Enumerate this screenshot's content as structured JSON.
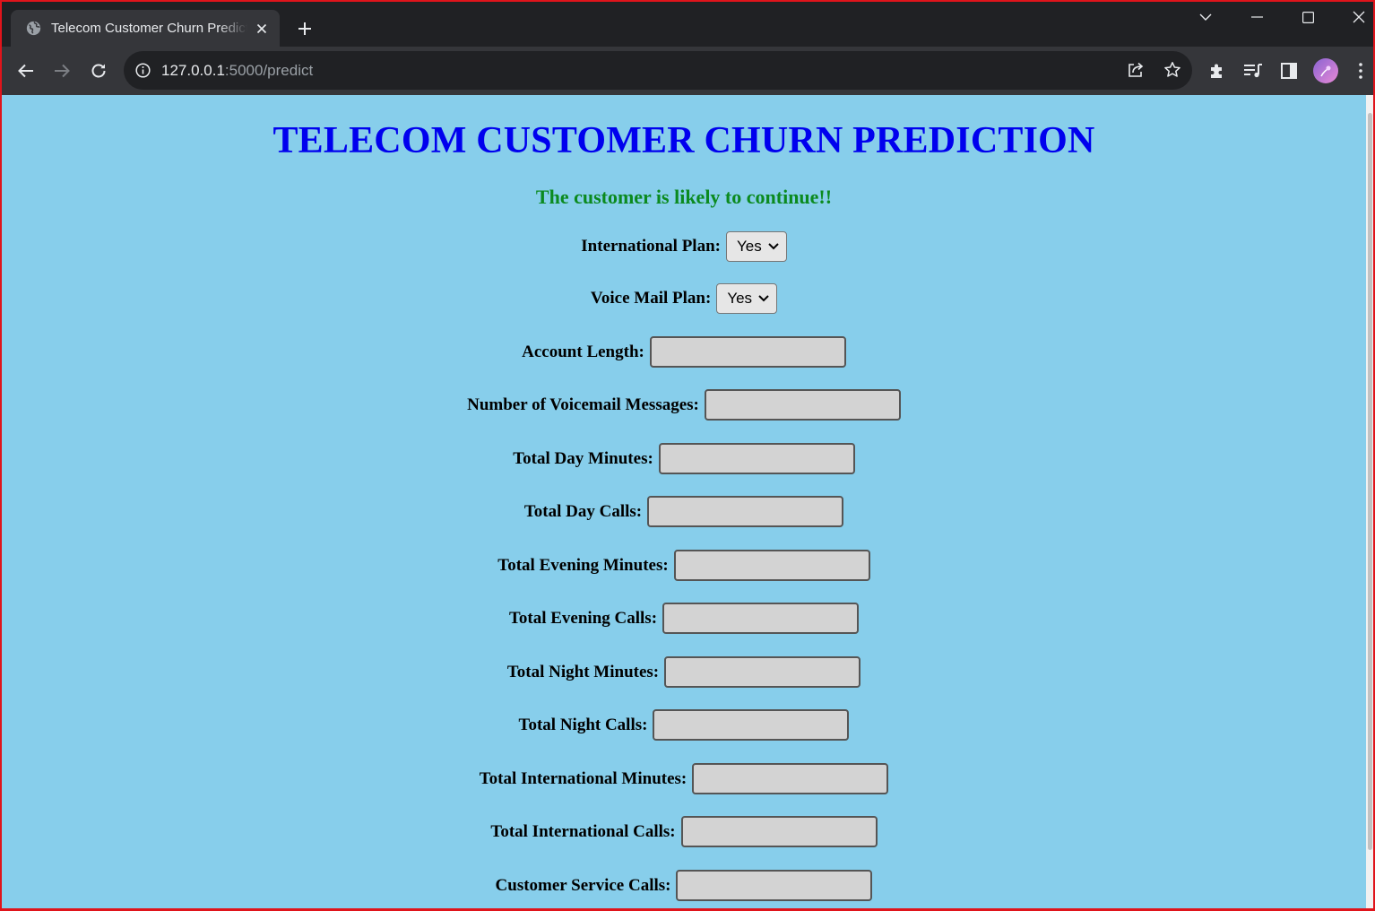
{
  "browser": {
    "tab_title": "Telecom Customer Churn Prediction",
    "url_host": "127.0.0.1",
    "url_rest": ":5000/predict"
  },
  "page": {
    "title": "TELECOM CUSTOMER CHURN PREDICTION",
    "result": "The customer is likely to continue!!",
    "selects": [
      {
        "label": "International Plan:",
        "value": "Yes"
      },
      {
        "label": "Voice Mail Plan:",
        "value": "Yes"
      }
    ],
    "fields": [
      {
        "label": "Account Length:",
        "value": ""
      },
      {
        "label": "Number of Voicemail Messages:",
        "value": ""
      },
      {
        "label": "Total Day Minutes:",
        "value": ""
      },
      {
        "label": "Total Day Calls:",
        "value": ""
      },
      {
        "label": "Total Evening Minutes:",
        "value": ""
      },
      {
        "label": "Total Evening Calls:",
        "value": ""
      },
      {
        "label": "Total Night Minutes:",
        "value": ""
      },
      {
        "label": "Total Night Calls:",
        "value": ""
      },
      {
        "label": "Total International Minutes:",
        "value": ""
      },
      {
        "label": "Total International Calls:",
        "value": ""
      },
      {
        "label": "Customer Service Calls:",
        "value": ""
      }
    ]
  },
  "colors": {
    "background": "#87ceeb",
    "title": "#0000ee",
    "result": "#0b8a1f",
    "input_bg": "#d3d3d3"
  }
}
